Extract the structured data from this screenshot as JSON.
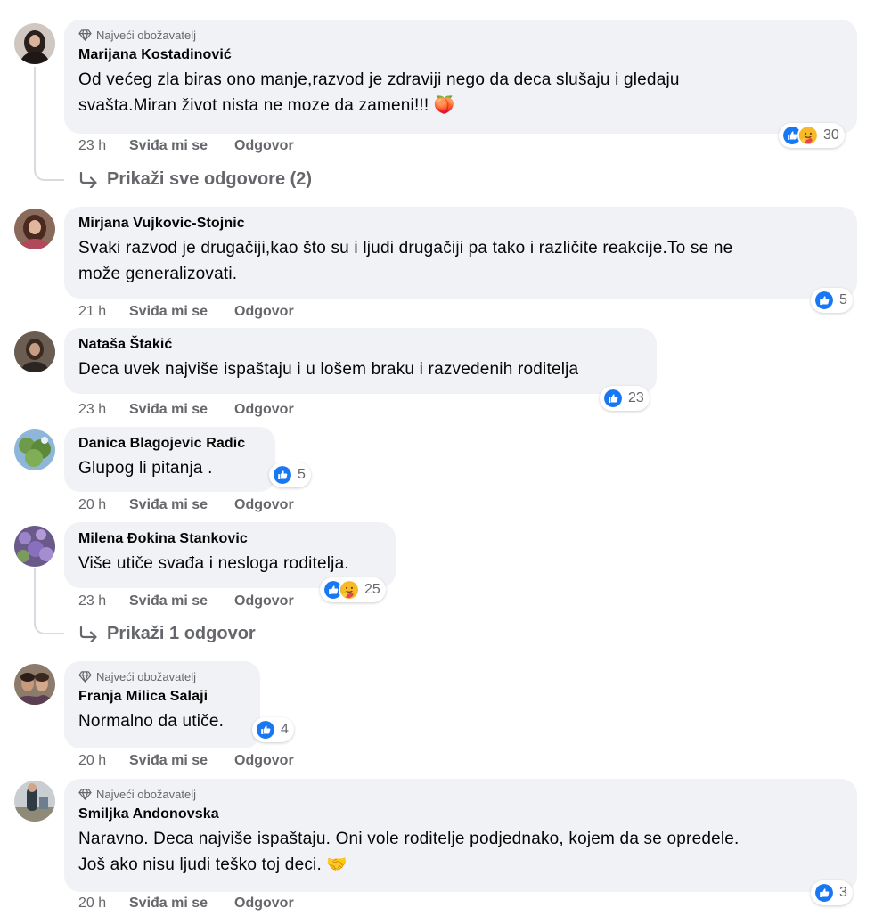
{
  "fan_badge": "Najveći obožavatelj",
  "actions": {
    "like": "Sviđa mi se",
    "reply": "Odgovor"
  },
  "icons": {
    "like": "thumbs-up-icon",
    "care": "care-hug-icon",
    "fan": "diamond-icon",
    "reply_arrow": "reply-arrow-icon"
  },
  "colors": {
    "like_blue": "#1877f2",
    "care_yellow": "#f7b928",
    "bubble": "#f0f2f5",
    "muted": "#65676b"
  },
  "comments": [
    {
      "author": "Marijana Kostadinović",
      "text_line1": "Od većeg zla biras ono manje,razvod je zdraviji nego da deca slušaju i gledaju",
      "text_line2": "svašta.Miran život nista ne moze da zameni!!! 🍑",
      "time": "23 h",
      "reactions": "30",
      "replies_label": "Prikaži sve odgovore (2)"
    },
    {
      "author": "Mirjana Vujkovic-Stojnic",
      "text_line1": "Svaki razvod je drugačiji,kao što su i ljudi drugačiji pa tako i različite reakcije.To se ne",
      "text_line2": "može generalizovati.",
      "time": "21 h",
      "reactions": "5"
    },
    {
      "author": "Nataša Štakić",
      "text": "Deca uvek najviše ispaštaju i u lošem braku i razvedenih roditelja",
      "time": "23 h",
      "reactions": "23"
    },
    {
      "author": "Danica Blagojevic Radic",
      "text": "Glupog li pitanja .",
      "time": "20 h",
      "reactions": "5"
    },
    {
      "author": "Milena Đokina Stankovic",
      "text": "Više utiče svađa i nesloga roditelja.",
      "time": "23 h",
      "reactions": "25",
      "replies_label": "Prikaži 1 odgovor"
    },
    {
      "author": "Franja Milica Salaji",
      "text": "Normalno da utiče.",
      "time": "20 h",
      "reactions": "4"
    },
    {
      "author": "Smiljka Andonovska",
      "text_line1": "Naravno. Deca najviše ispaštaju. Oni vole roditelje podjednako, kojem da se opredele.",
      "text_line2": "Još ako nisu ljudi teško toj deci. 🤝",
      "time": "20 h",
      "reactions": "3"
    }
  ]
}
